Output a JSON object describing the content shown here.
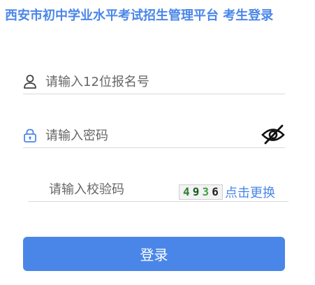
{
  "header": {
    "title": "西安市初中学业水平考试招生管理平台 考生登录"
  },
  "form": {
    "username": {
      "placeholder": "请输入12位报名号",
      "value": "",
      "icon": "user-icon"
    },
    "password": {
      "placeholder": "请输入密码",
      "value": "",
      "icon": "lock-icon",
      "toggle_icon": "eye-slash-icon"
    },
    "captcha": {
      "placeholder": "请输入校验码",
      "value": "",
      "chars": [
        "4",
        "9",
        "3",
        "6"
      ],
      "refresh_label": "点击更换"
    },
    "login_label": "登录"
  },
  "colors": {
    "accent": "#4a86e8",
    "captcha_chars": [
      "#2e7d32",
      "#1b5e20",
      "#43a047",
      "#222222"
    ]
  }
}
